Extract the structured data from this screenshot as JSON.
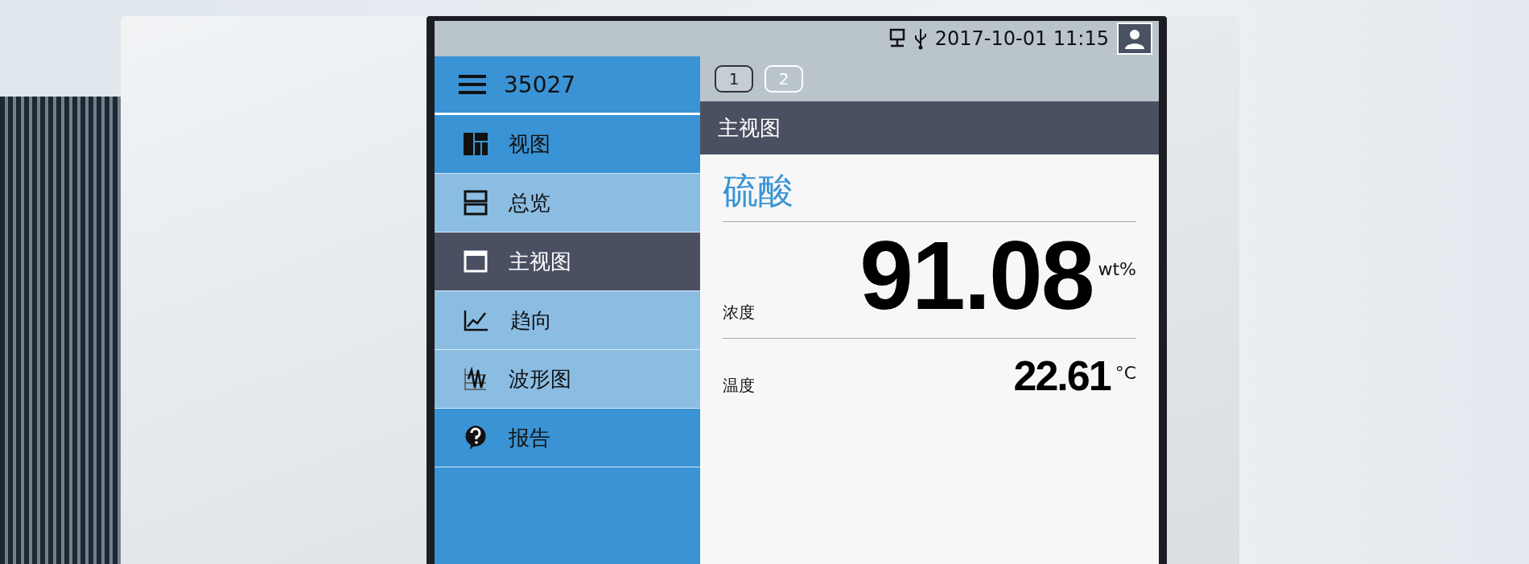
{
  "status_bar": {
    "datetime": "2017-10-01 11:15"
  },
  "sidebar": {
    "title": "35027",
    "items": [
      {
        "label": "视图",
        "kind": "group",
        "selected": false
      },
      {
        "label": "总览",
        "kind": "item",
        "selected": false
      },
      {
        "label": "主视图",
        "kind": "item",
        "selected": true
      },
      {
        "label": "趋向",
        "kind": "item",
        "selected": false
      },
      {
        "label": "波形图",
        "kind": "item",
        "selected": false
      },
      {
        "label": "报告",
        "kind": "group",
        "selected": false
      }
    ]
  },
  "pages": [
    {
      "label": "1",
      "selected": true
    },
    {
      "label": "2",
      "selected": false
    }
  ],
  "view": {
    "title": "主视图",
    "substance": "硫酸",
    "measurements": [
      {
        "name": "浓度",
        "value": "91.08",
        "unit": "wt%",
        "kind": "primary"
      },
      {
        "name": "温度",
        "value": "22.61",
        "unit": "°C",
        "kind": "secondary"
      }
    ]
  }
}
